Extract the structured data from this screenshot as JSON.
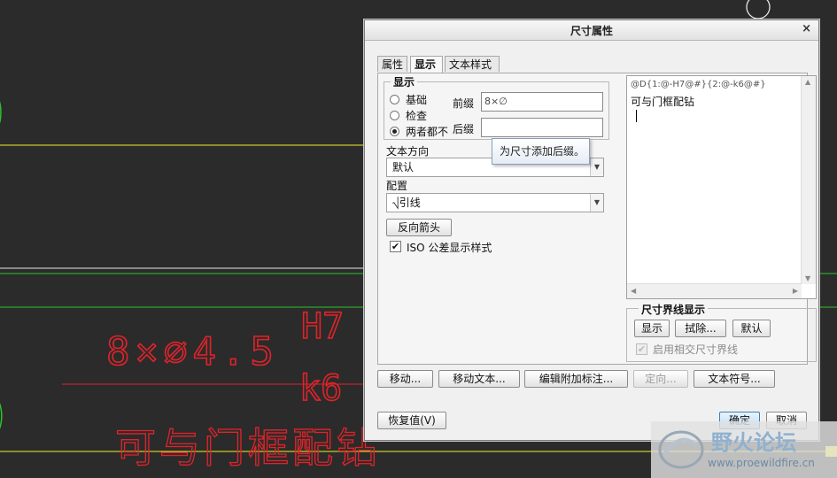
{
  "dialog": {
    "title": "尺寸属性",
    "close": "×",
    "tabs": [
      "属性",
      "显示",
      "文本样式"
    ]
  },
  "display_group": {
    "label": "显示",
    "radios": [
      "基础",
      "检查",
      "两者都不"
    ],
    "selected_index": 2,
    "prefix_label": "前缀",
    "prefix_value": "8×∅",
    "suffix_label": "后缀",
    "suffix_value": ""
  },
  "tooltip": "为尺寸添加后缀。",
  "text_direction": {
    "label": "文本方向",
    "value": "默认"
  },
  "placement": {
    "label": "配置",
    "value": "⎷引线"
  },
  "reverse_arrow_button": "反向箭头",
  "iso_checkbox": {
    "label": "ISO 公差显示样式",
    "checked": true
  },
  "dim_text": {
    "line1": "@D{1:@-H7@#}{2:@-k6@#}",
    "line2": "可与门框配钻"
  },
  "witness_group": {
    "label": "尺寸界线显示",
    "buttons": [
      "显示",
      "拭除...",
      "默认"
    ],
    "checkbox_label": "启用相交尺寸界线"
  },
  "bottom_buttons": [
    "移动...",
    "移动文本...",
    "编辑附加标注...",
    "定向...",
    "文本符号..."
  ],
  "restore_button": "恢复值(V)",
  "ok_button": "确定",
  "cancel_button": "取消",
  "cad_annotation": {
    "dimension_text": "8×∅4.5",
    "upper_tol": "H7",
    "lower_tol": "k6",
    "note": "可与门框配钻"
  },
  "watermark": {
    "title": "野火论坛",
    "url": "www.proewildfire.cn"
  },
  "colors": {
    "cad_background": "#2b2b2b",
    "annotation_red": "#e2232a",
    "yellow_line": "#f2f227",
    "green_line": "#2cc22c",
    "white_line": "#e6e6e6"
  }
}
